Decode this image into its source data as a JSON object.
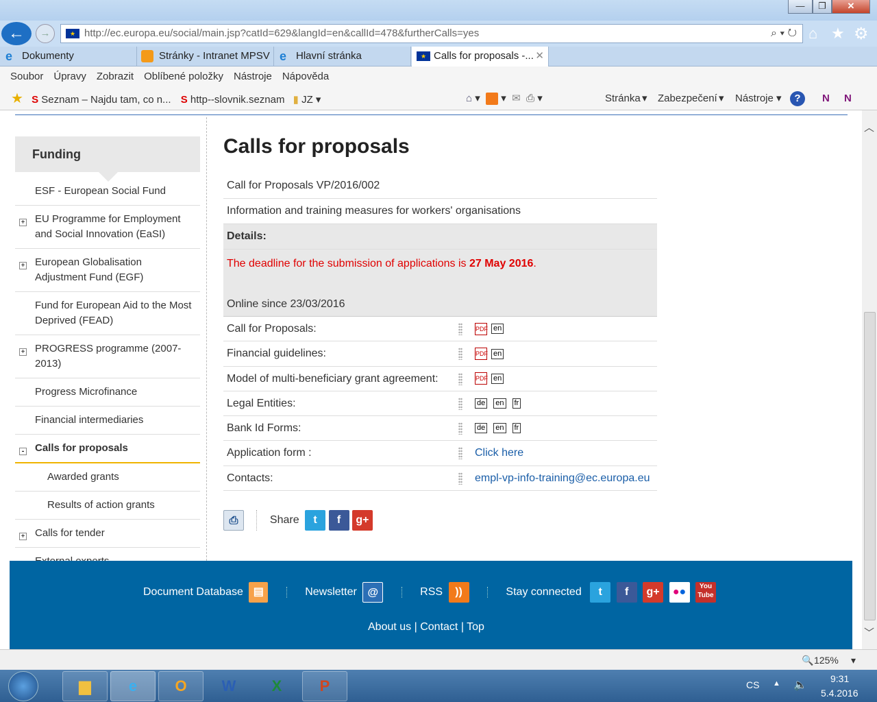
{
  "browser": {
    "address": "http://ec.europa.eu/social/main.jsp?catId=629&langId=en&callId=478&furtherCalls=yes",
    "tabs": [
      {
        "label": "Dokumenty"
      },
      {
        "label": "Stránky - Intranet MPSV"
      },
      {
        "label": "Hlavní stránka"
      },
      {
        "label": "Calls for proposals -..."
      }
    ],
    "menu": [
      "Soubor",
      "Úpravy",
      "Zobrazit",
      "Oblíbené položky",
      "Nástroje",
      "Nápověda"
    ],
    "favorites": [
      "Seznam – Najdu tam, co n...",
      "http--slovnik.seznam",
      "JZ"
    ],
    "commands": [
      "Stránka",
      "Zabezpečení",
      "Nástroje"
    ],
    "zoom": "125%"
  },
  "sidebar": {
    "heading": "Funding",
    "items": [
      {
        "label": "ESF - European Social Fund"
      },
      {
        "label": "EU Programme for Employment and Social Innovation (EaSI)",
        "expand": "+"
      },
      {
        "label": "European Globalisation Adjustment Fund (EGF)",
        "expand": "+"
      },
      {
        "label": "Fund for European Aid to the Most Deprived (FEAD)"
      },
      {
        "label": "PROGRESS programme (2007-2013)",
        "expand": "+"
      },
      {
        "label": "Progress Microfinance"
      },
      {
        "label": "Financial intermediaries"
      },
      {
        "label": "Calls for proposals",
        "expand": "-",
        "active": true
      },
      {
        "label": "Awarded grants",
        "sub": true
      },
      {
        "label": "Results of action grants",
        "sub": true
      },
      {
        "label": "Calls for tender",
        "expand": "+"
      },
      {
        "label": "External experts"
      }
    ]
  },
  "main": {
    "title": "Calls for proposals",
    "call_ref": "Call for Proposals VP/2016/002",
    "call_title": "Information and training measures for workers' organisations",
    "details_label": "Details:",
    "deadline_text": "The deadline for the submission of applications is ",
    "deadline_date": "27 May 2016",
    "deadline_end": ".",
    "online_since": "Online since 23/03/2016",
    "files": [
      {
        "label": "Call for Proposals:",
        "pdf": true,
        "langs": [
          "en"
        ]
      },
      {
        "label": "Financial guidelines:",
        "pdf": true,
        "langs": [
          "en"
        ]
      },
      {
        "label": "Model of multi-beneficiary grant agreement:",
        "pdf": true,
        "langs": [
          "en"
        ]
      },
      {
        "label": "Legal Entities:",
        "langs": [
          "de",
          "en",
          "fr"
        ]
      },
      {
        "label": "Bank Id Forms:",
        "langs": [
          "de",
          "en",
          "fr"
        ]
      }
    ],
    "application_label": "Application form :",
    "application_link": "Click here",
    "contacts_label": "Contacts:",
    "contacts_email": "empl-vp-info-training@ec.europa.eu",
    "share_label": "Share"
  },
  "footer": {
    "document_database": "Document Database",
    "newsletter": "Newsletter",
    "rss": "RSS",
    "stay_connected": "Stay connected",
    "about": "About us",
    "contact": "Contact",
    "top": "Top",
    "sep": "|"
  },
  "taskbar": {
    "lang": "CS",
    "time": "9:31",
    "date": "5.4.2016"
  },
  "colors": {
    "footer": "#0065a2",
    "deadline": "#e00000",
    "link": "#1a5ea8",
    "active_underline": "#f0b400"
  }
}
